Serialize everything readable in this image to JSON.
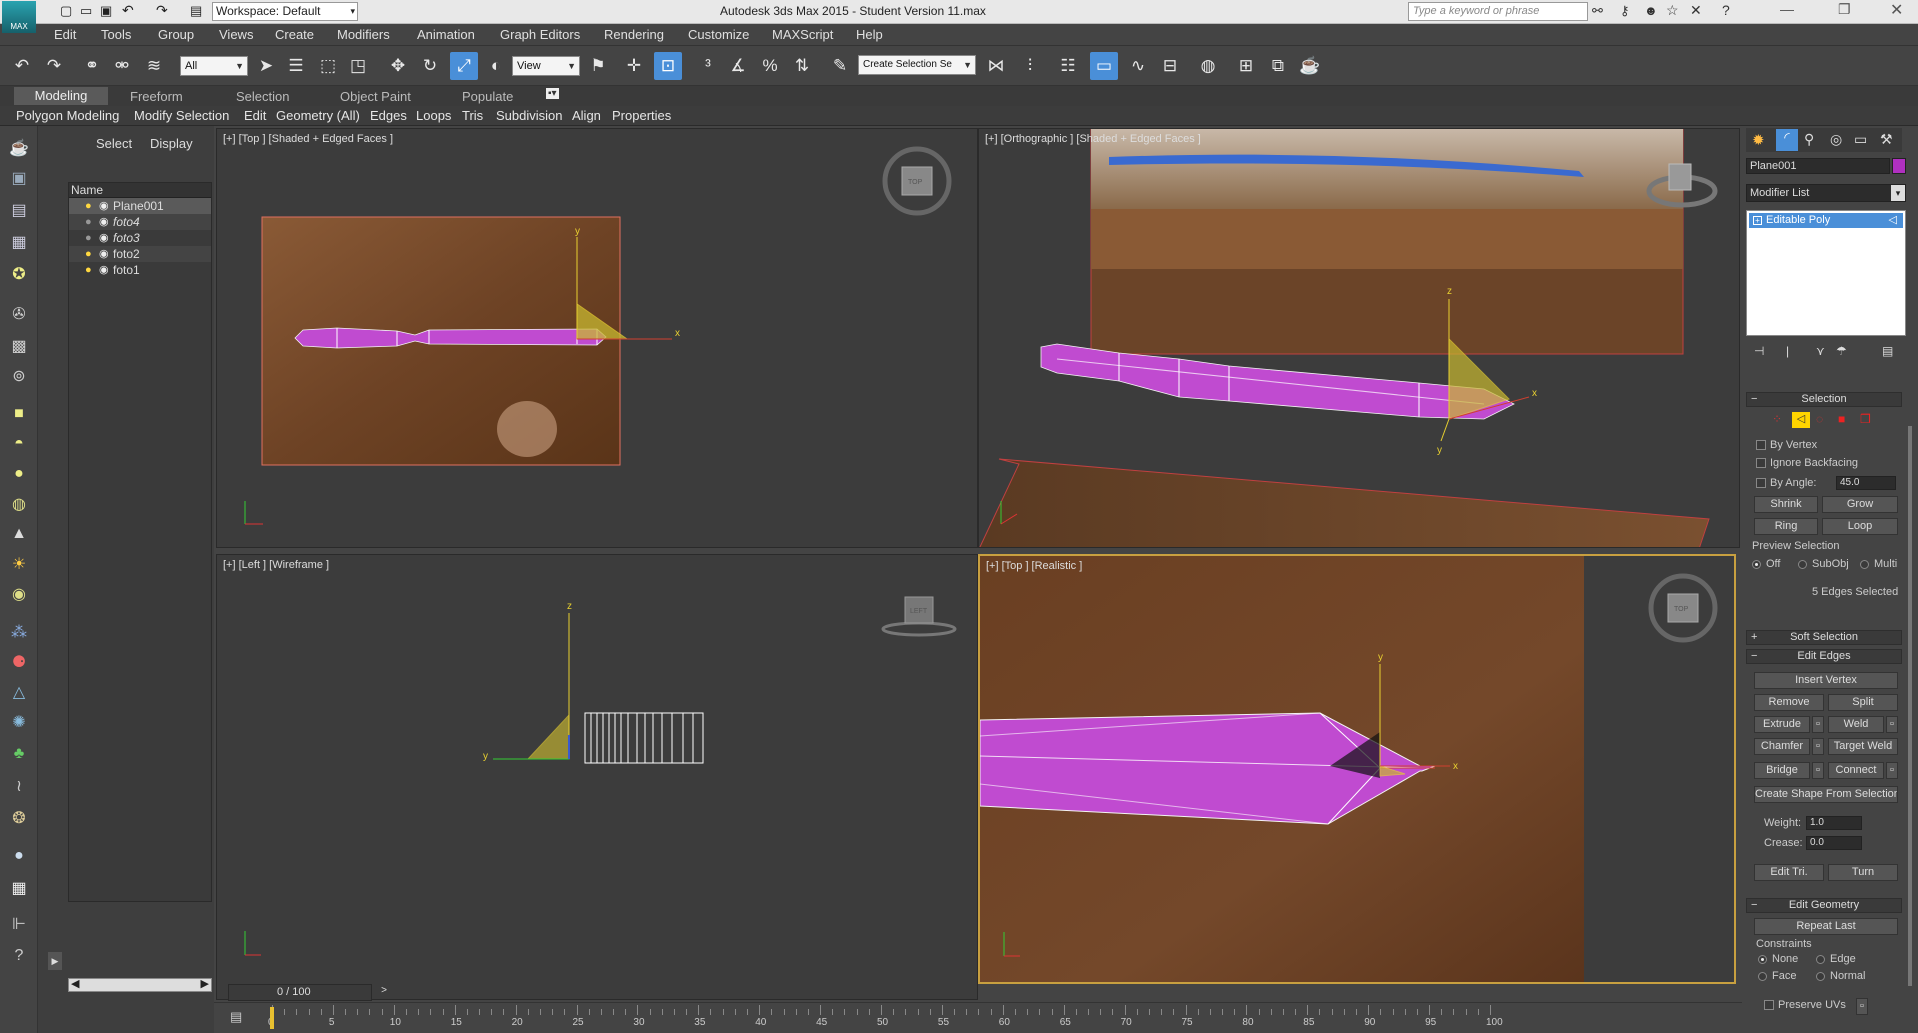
{
  "titlebar": {
    "logo": "MAX",
    "workspace": "Workspace: Default",
    "app_title": "Autodesk 3ds Max  2015  - Student Version    11.max",
    "search_placeholder": "Type a keyword or phrase"
  },
  "menu": [
    "Edit",
    "Tools",
    "Group",
    "Views",
    "Create",
    "Modifiers",
    "Animation",
    "Graph Editors",
    "Rendering",
    "Customize",
    "MAXScript",
    "Help"
  ],
  "toolbar": {
    "filter_value": "All",
    "ref_coord_value": "View",
    "selection_set_value": "Create Selection Se"
  },
  "ribbon": {
    "tabs": [
      "Modeling",
      "Freeform",
      "Selection",
      "Object Paint",
      "Populate"
    ],
    "items": [
      "Polygon Modeling",
      "Modify Selection",
      "Edit",
      "Geometry (All)",
      "Edges",
      "Loops",
      "Tris",
      "Subdivision",
      "Align",
      "Properties"
    ]
  },
  "scene_explorer": {
    "tabs": [
      "Select",
      "Display"
    ],
    "column_header": "Name",
    "rows": [
      {
        "name": "Plane001",
        "light": "on",
        "selected": true,
        "italic": false
      },
      {
        "name": "foto4",
        "light": "off",
        "selected": false,
        "italic": true
      },
      {
        "name": "foto3",
        "light": "off",
        "selected": false,
        "italic": true
      },
      {
        "name": "foto2",
        "light": "on",
        "selected": false,
        "italic": false
      },
      {
        "name": "foto1",
        "light": "on",
        "selected": false,
        "italic": false
      }
    ]
  },
  "viewports": {
    "top_left": "[+] [Top ] [Shaded + Edged Faces ]",
    "top_right": "[+] [Orthographic ] [Shaded + Edged Faces ]",
    "bottom_left": "[+] [Left ] [Wireframe ]",
    "bottom_right": "[+] [Top ] [Realistic ]",
    "cube_top": "TOP",
    "cube_left": "LEFT"
  },
  "command_panel": {
    "object_name": "Plane001",
    "object_color": "#b030c0",
    "modifier_list_label": "Modifier List",
    "stack_item": "Editable Poly",
    "selection": {
      "title": "Selection",
      "by_vertex": "By Vertex",
      "ignore_backfacing": "Ignore Backfacing",
      "by_angle": "By Angle:",
      "angle_value": "45.0",
      "shrink": "Shrink",
      "grow": "Grow",
      "ring": "Ring",
      "loop": "Loop",
      "preview_label": "Preview Selection",
      "preview_off": "Off",
      "preview_subobj": "SubObj",
      "preview_multi": "Multi",
      "status": "5 Edges Selected"
    },
    "soft_selection": "Soft Selection",
    "edit_edges": {
      "title": "Edit Edges",
      "insert_vertex": "Insert Vertex",
      "remove": "Remove",
      "split": "Split",
      "extrude": "Extrude",
      "weld": "Weld",
      "chamfer": "Chamfer",
      "target_weld": "Target Weld",
      "bridge": "Bridge",
      "connect": "Connect",
      "create_shape": "Create Shape From Selection",
      "weight_label": "Weight:",
      "weight_value": "1.0",
      "crease_label": "Crease:",
      "crease_value": "0.0",
      "edit_tri": "Edit Tri.",
      "turn": "Turn"
    },
    "edit_geometry": {
      "title": "Edit Geometry",
      "repeat_last": "Repeat Last",
      "constraints": "Constraints",
      "none": "None",
      "edge": "Edge",
      "face": "Face",
      "normal": "Normal",
      "preserve_uvs": "Preserve UVs"
    }
  },
  "timeline": {
    "frame": "0 / 100",
    "ticks": [
      "0",
      "5",
      "10",
      "15",
      "20",
      "25",
      "30",
      "35",
      "40",
      "45",
      "50",
      "55",
      "60",
      "65",
      "70",
      "75",
      "80",
      "85",
      "90",
      "95",
      "100"
    ]
  },
  "colors": {
    "selection_blue": "#4a8fd8",
    "mesh_pink": "#c04bd0",
    "wood": "#6e4325",
    "gizmo_yellow": "#e8d030"
  }
}
